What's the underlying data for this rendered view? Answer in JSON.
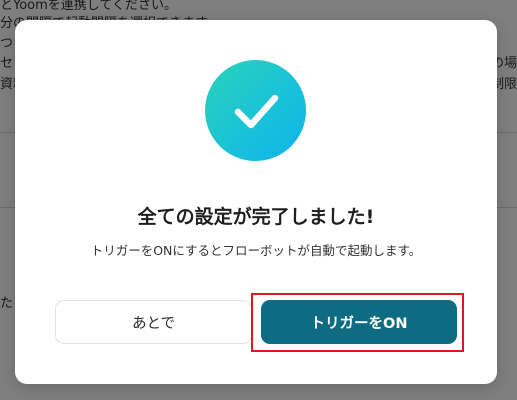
{
  "background": {
    "lines": [
      "とYoomを連携してください。",
      "分の間隔で起動間隔を選択できます。",
      "つき",
      "セン",
      "資料"
    ],
    "right_lines": [
      "の場",
      "制限"
    ],
    "side_text": "た"
  },
  "modal": {
    "icon": "check-icon",
    "title": "全ての設定が完了しました!",
    "description": "トリガーをONにするとフローボットが自動で起動します。",
    "later_button": "あとで",
    "on_button": "トリガーをON"
  },
  "colors": {
    "accent": "#0f6b82",
    "check_gradient_start": "#2ad3b7",
    "check_gradient_end": "#10b3e8",
    "highlight": "#e2161d"
  }
}
